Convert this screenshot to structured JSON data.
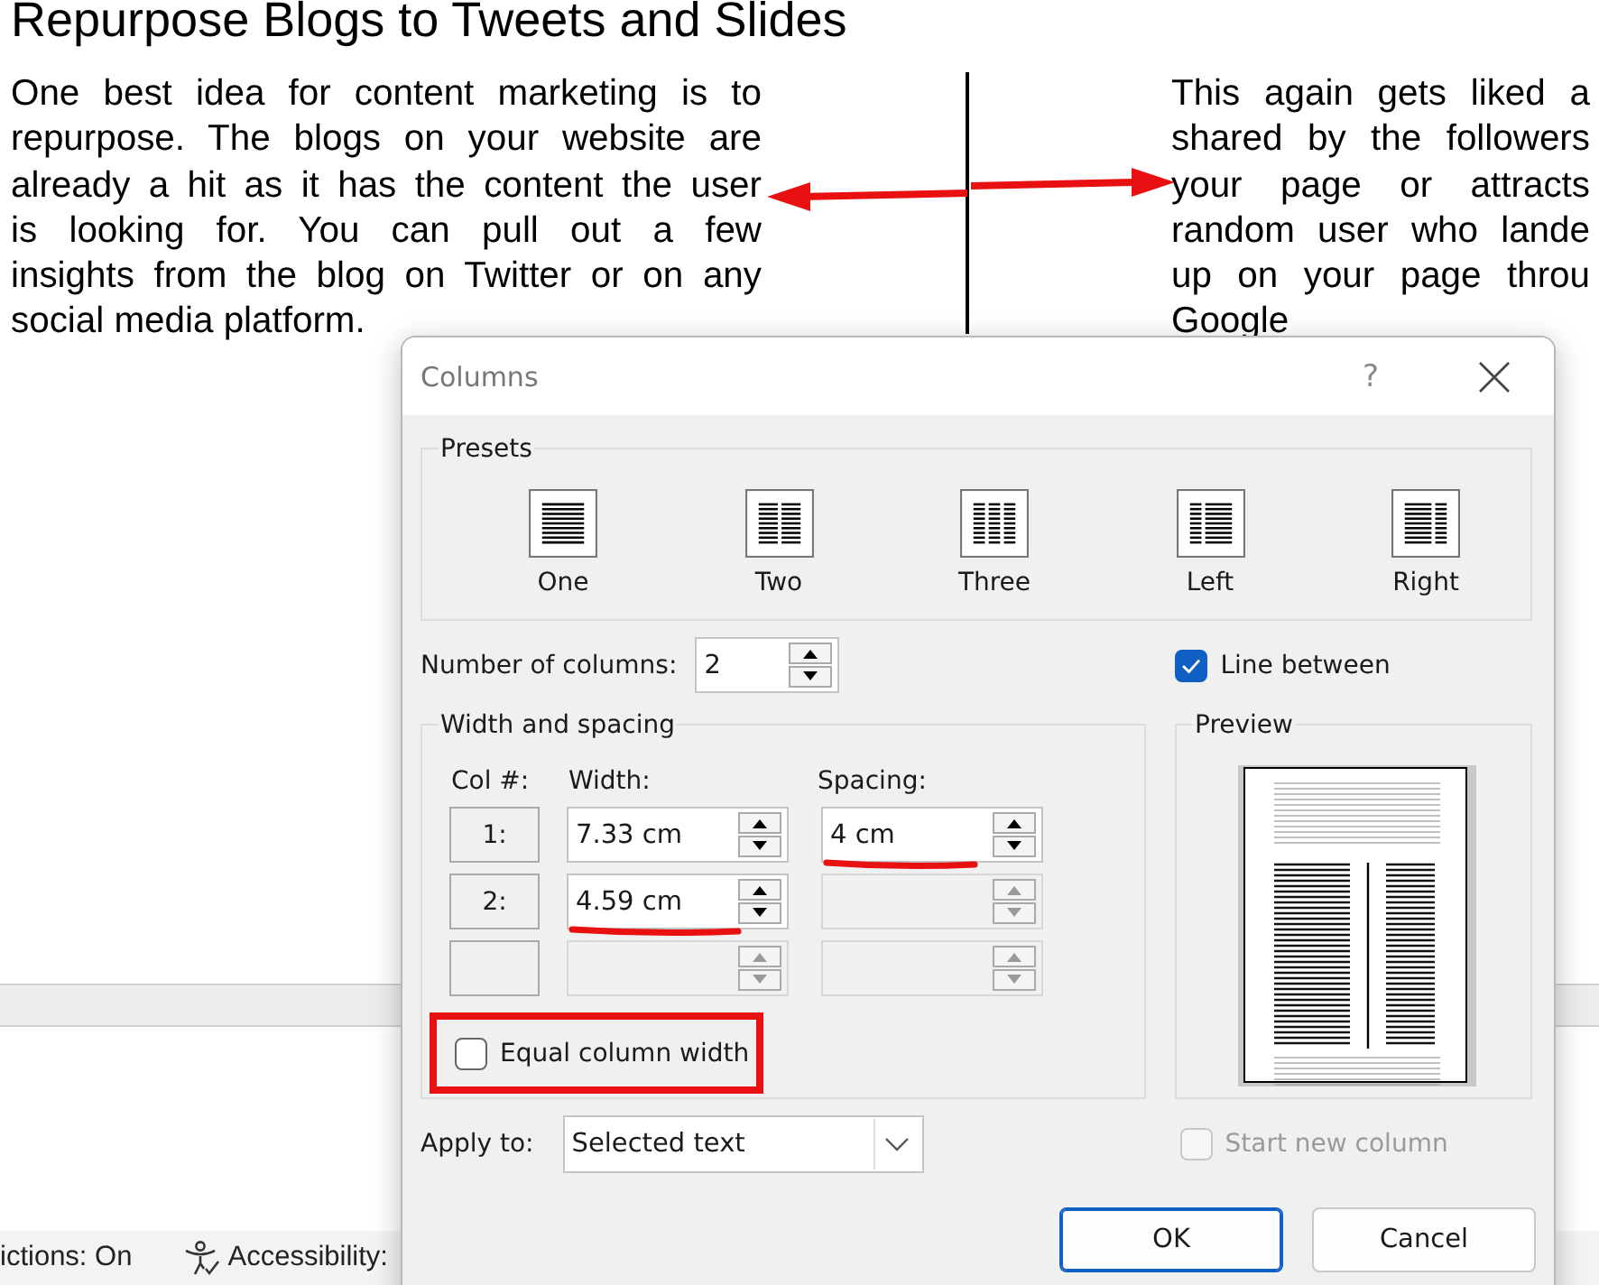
{
  "document": {
    "heading": "Repurpose Blogs to Tweets and Slides",
    "left_column": {
      "lines": [
        "One best idea for content marketing is to",
        "repurpose. The blogs on your website are",
        "already a hit as it has the content the user",
        "is looking for. You can pull out a few",
        "insights from the blog on Twitter or on any",
        "social media platform."
      ]
    },
    "right_column": {
      "lines": [
        "This again gets liked a",
        "shared by the followers",
        "your page or attracts",
        "random user who lande",
        "up on your page throu",
        "Google"
      ]
    },
    "column_line": {
      "arrows": true
    }
  },
  "status_bar": {
    "items": [
      {
        "kind": "text",
        "text": "ictions: On"
      },
      {
        "kind": "accessibility",
        "text": "Accessibility:"
      }
    ]
  },
  "dialog": {
    "title": "Columns",
    "help": "?",
    "presets": {
      "legend": "Presets",
      "items": [
        {
          "kind": "one",
          "label": "One"
        },
        {
          "kind": "two",
          "label": "Two"
        },
        {
          "kind": "three",
          "label": "Three"
        },
        {
          "kind": "left",
          "label": "Left"
        },
        {
          "kind": "right",
          "label": "Right"
        }
      ]
    },
    "number_of_columns": {
      "label": "Number of columns:",
      "value": "2"
    },
    "line_between": {
      "label": "Line between",
      "checked": true
    },
    "width_and_spacing": {
      "legend": "Width and spacing",
      "headers": [
        "Col #:",
        "Width:",
        "Spacing:"
      ],
      "rows": [
        {
          "col": "1:",
          "width": "7.33 cm",
          "spacing": "4 cm",
          "width_disabled": false,
          "spacing_disabled": false,
          "width_underlined": false,
          "spacing_underlined": true
        },
        {
          "col": "2:",
          "width": "4.59 cm",
          "width_disabled": false,
          "spacing_disabled": true,
          "width_underlined": true,
          "spacing_underlined": false
        },
        {
          "width_disabled": true,
          "spacing_disabled": true,
          "width_underlined": false,
          "spacing_underlined": false
        }
      ]
    },
    "equal_column_width": {
      "label": "Equal column width",
      "checked": false,
      "highlighted": true
    },
    "preview": {
      "legend": "Preview"
    },
    "apply_to": {
      "label": "Apply to:",
      "value": "Selected text"
    },
    "start_new_column": {
      "label": "Start new column",
      "checked": false,
      "disabled": true
    },
    "buttons": [
      {
        "label": "OK",
        "kind": "default"
      },
      {
        "label": "Cancel",
        "kind": "normal"
      }
    ]
  }
}
